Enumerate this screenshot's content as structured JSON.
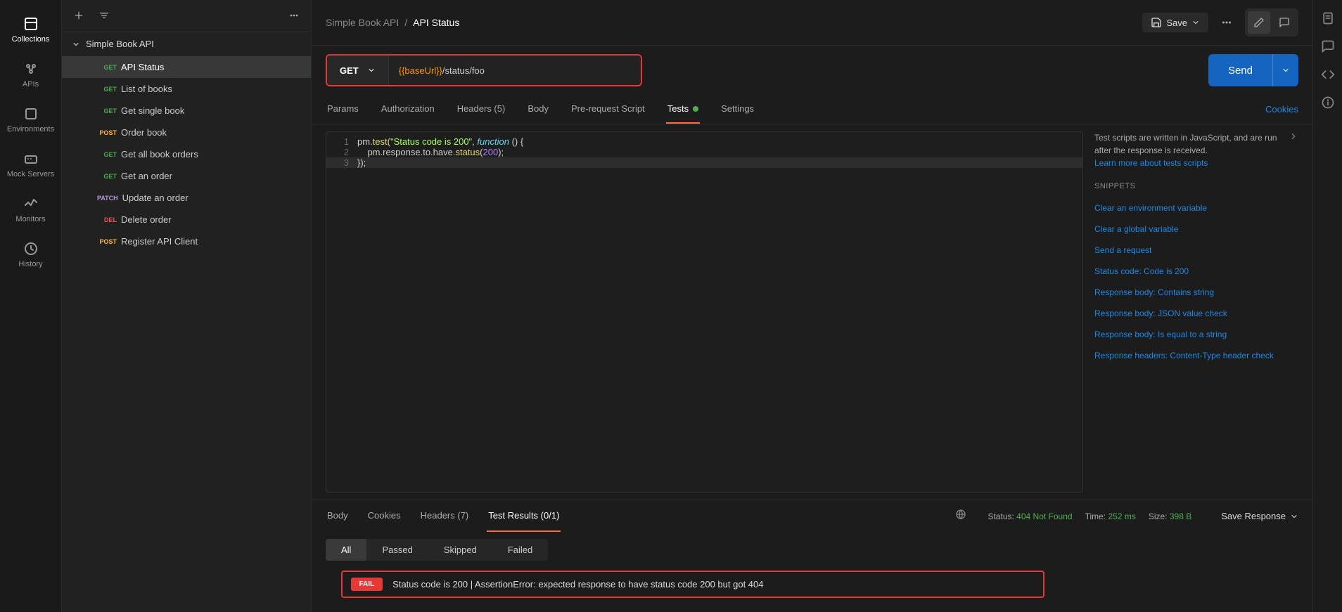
{
  "rail": {
    "collections": "Collections",
    "apis": "APIs",
    "environments": "Environments",
    "mock": "Mock Servers",
    "monitors": "Monitors",
    "history": "History"
  },
  "sidebar": {
    "collection_name": "Simple Book API",
    "items": [
      {
        "method": "GET",
        "mclass": "m-get",
        "label": "API Status",
        "active": true
      },
      {
        "method": "GET",
        "mclass": "m-get",
        "label": "List of books"
      },
      {
        "method": "GET",
        "mclass": "m-get",
        "label": "Get single book"
      },
      {
        "method": "POST",
        "mclass": "m-post",
        "label": "Order book"
      },
      {
        "method": "GET",
        "mclass": "m-get",
        "label": "Get all book orders"
      },
      {
        "method": "GET",
        "mclass": "m-get",
        "label": "Get an order"
      },
      {
        "method": "PATCH",
        "mclass": "m-patch",
        "label": "Update an order"
      },
      {
        "method": "DEL",
        "mclass": "m-del",
        "label": "Delete order"
      },
      {
        "method": "POST",
        "mclass": "m-post",
        "label": "Register API Client"
      }
    ]
  },
  "breadcrumb": {
    "parent": "Simple Book API",
    "sep": "/",
    "current": "API Status"
  },
  "actions": {
    "save": "Save"
  },
  "request": {
    "method": "GET",
    "url_var": "{{baseUrl}}",
    "url_path": "/status/foo",
    "send": "Send"
  },
  "tabs": {
    "params": "Params",
    "auth": "Authorization",
    "headers": "Headers (5)",
    "body": "Body",
    "prereq": "Pre-request Script",
    "tests": "Tests",
    "settings": "Settings",
    "cookies": "Cookies"
  },
  "code": {
    "l1a": "pm.",
    "l1b": "test",
    "l1c": "(",
    "l1d": "\"Status code is 200\"",
    "l1e": ", ",
    "l1f": "function",
    "l1g": " () {",
    "l2a": "    pm.response.to.have.",
    "l2b": "status",
    "l2c": "(",
    "l2d": "200",
    "l2e": ");",
    "l3": "});"
  },
  "snippets": {
    "desc": "Test scripts are written in JavaScript, and are run after the response is received.",
    "learn": "Learn more about tests scripts",
    "title": "SNIPPETS",
    "items": [
      "Clear an environment variable",
      "Clear a global variable",
      "Send a request",
      "Status code: Code is 200",
      "Response body: Contains string",
      "Response body: JSON value check",
      "Response body: Is equal to a string",
      "Response headers: Content-Type header check"
    ]
  },
  "response": {
    "tabs": {
      "body": "Body",
      "cookies": "Cookies",
      "headers": "Headers (7)",
      "tests": "Test Results (0/1)"
    },
    "status_label": "Status:",
    "status_val": "404 Not Found",
    "time_label": "Time:",
    "time_val": "252 ms",
    "size_label": "Size:",
    "size_val": "398 B",
    "save": "Save Response"
  },
  "filters": {
    "all": "All",
    "passed": "Passed",
    "skipped": "Skipped",
    "failed": "Failed"
  },
  "result": {
    "badge": "FAIL",
    "text": "Status code is 200 | AssertionError: expected response to have status code 200 but got 404"
  }
}
